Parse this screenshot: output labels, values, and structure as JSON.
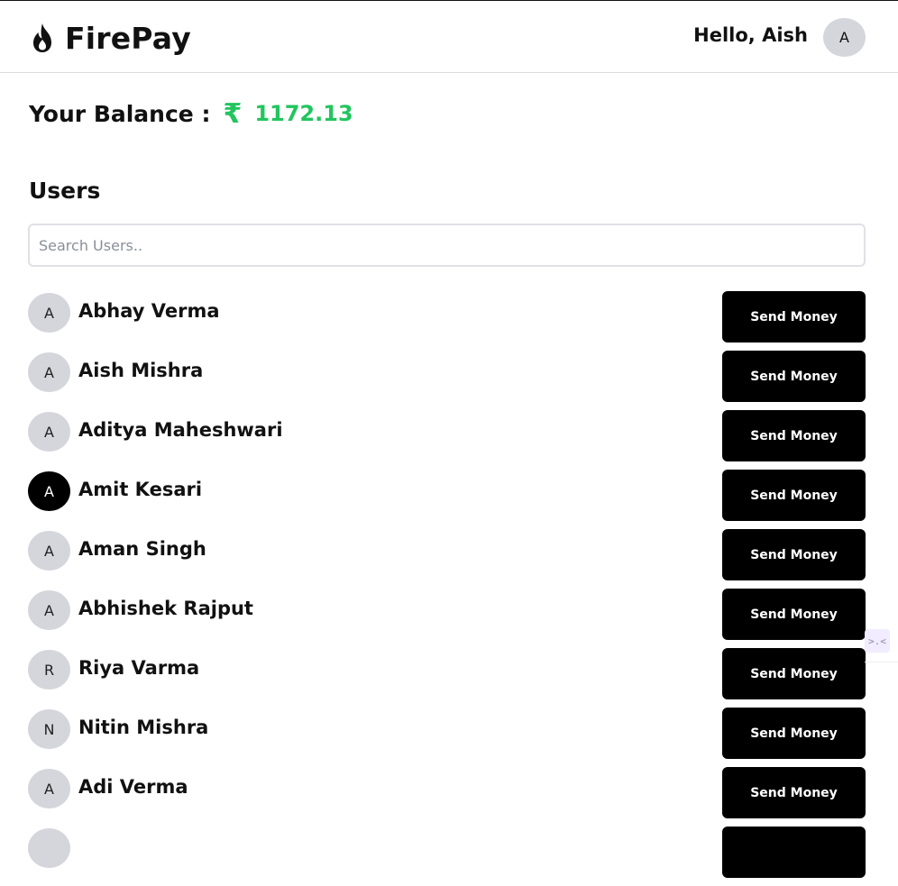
{
  "header": {
    "brand_name": "FirePay",
    "greeting": "Hello, Aish",
    "avatar_initial": "A"
  },
  "balance": {
    "label": "Your Balance :",
    "currency_symbol": "₹",
    "amount": "1172.13",
    "accent_color": "#22c55e"
  },
  "users_section": {
    "title": "Users",
    "search_placeholder": "Search Users..",
    "search_value": ""
  },
  "users": [
    {
      "initial": "A",
      "name": "Abhay Verma",
      "button_label": "Send Money",
      "highlighted": false
    },
    {
      "initial": "A",
      "name": "Aish Mishra",
      "button_label": "Send Money",
      "highlighted": false
    },
    {
      "initial": "A",
      "name": "Aditya Maheshwari",
      "button_label": "Send Money",
      "highlighted": false
    },
    {
      "initial": "A",
      "name": "Amit Kesari",
      "button_label": "Send Money",
      "highlighted": true
    },
    {
      "initial": "A",
      "name": "Aman Singh",
      "button_label": "Send Money",
      "highlighted": false
    },
    {
      "initial": "A",
      "name": "Abhishek Rajput",
      "button_label": "Send Money",
      "highlighted": false
    },
    {
      "initial": "R",
      "name": "Riya Varma",
      "button_label": "Send Money",
      "highlighted": false
    },
    {
      "initial": "N",
      "name": "Nitin Mishra",
      "button_label": "Send Money",
      "highlighted": false
    },
    {
      "initial": "A",
      "name": "Adi Verma",
      "button_label": "Send Money",
      "highlighted": false
    },
    {
      "initial": "",
      "name": "",
      "button_label": "",
      "highlighted": false
    }
  ],
  "icons": {
    "brand": "flame-icon",
    "side_widget": "extension-icon"
  },
  "side_widget_glyph": ">.<"
}
